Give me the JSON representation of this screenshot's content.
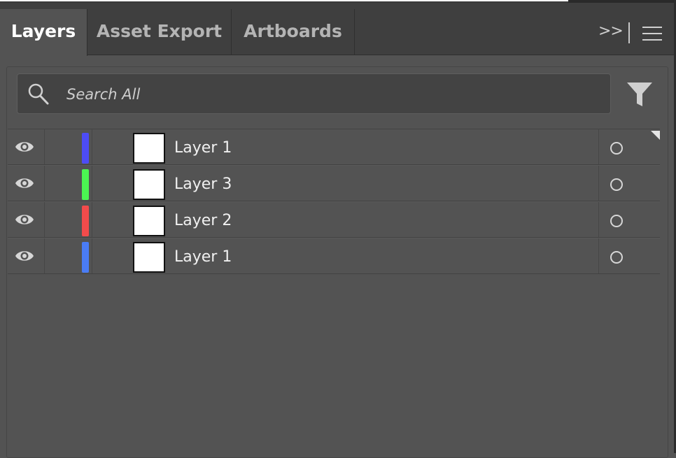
{
  "tabs": [
    {
      "label": "Layers",
      "active": true
    },
    {
      "label": "Asset Export",
      "active": false
    },
    {
      "label": "Artboards",
      "active": false
    }
  ],
  "tabbar": {
    "more_label": ">>",
    "more_icon": "double-chevron-right-icon",
    "menu_icon": "hamburger-menu-icon"
  },
  "search": {
    "placeholder": "Search All",
    "icon": "search-icon"
  },
  "filter": {
    "icon": "filter-icon"
  },
  "layers": [
    {
      "name": "Layer 1",
      "color": "#4d4cf5",
      "visible": true
    },
    {
      "name": "Layer 3",
      "color": "#4bf552",
      "visible": true
    },
    {
      "name": "Layer 2",
      "color": "#f24b4b",
      "visible": true
    },
    {
      "name": "Layer 1",
      "color": "#4a7cf5",
      "visible": true
    }
  ]
}
